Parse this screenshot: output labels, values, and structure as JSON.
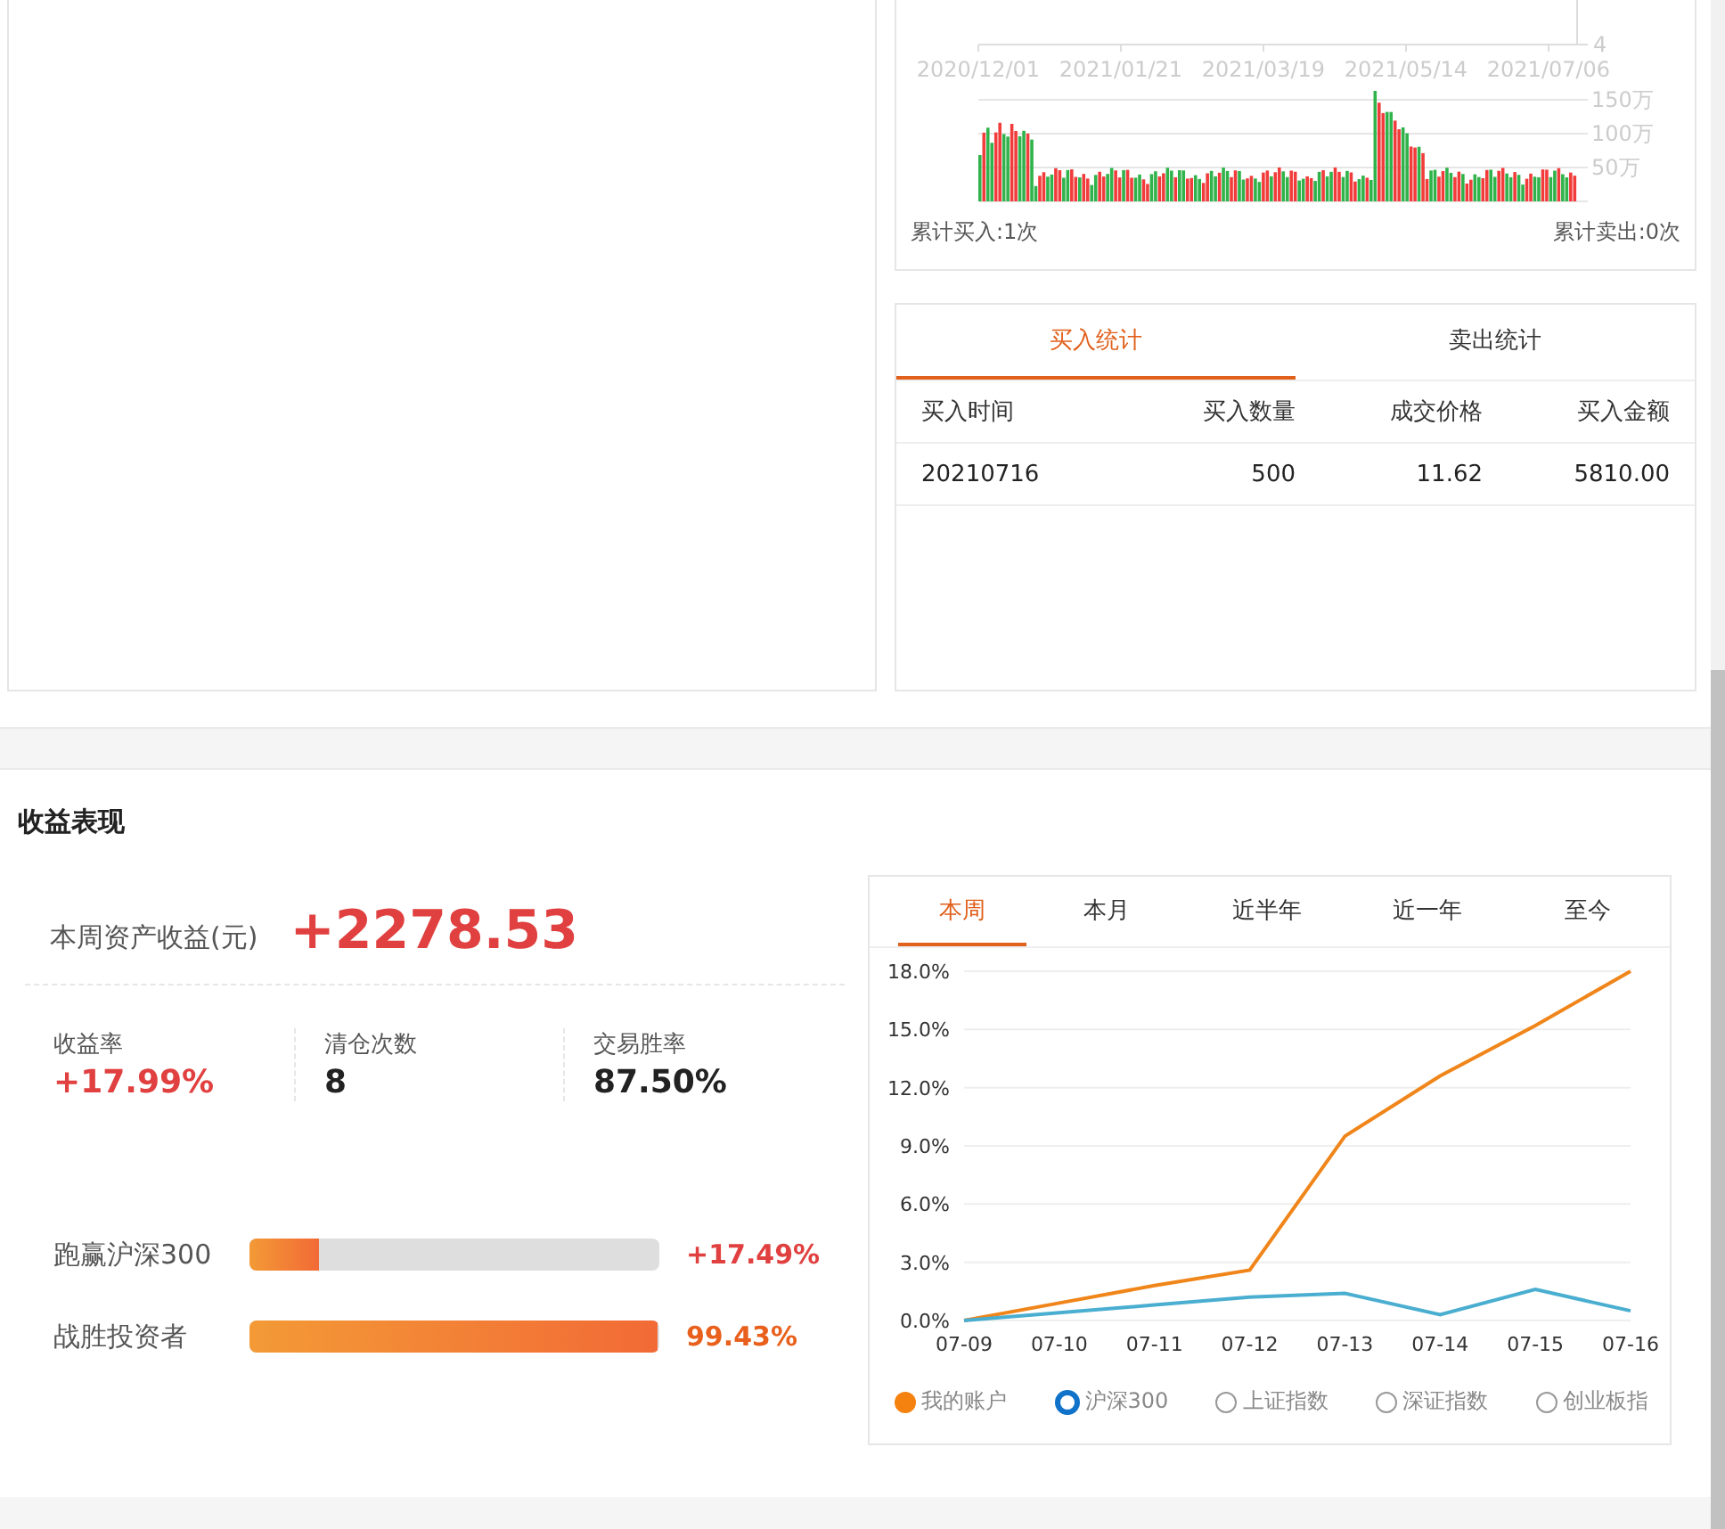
{
  "trade_chart": {
    "date_labels": [
      "2020/12/01",
      "2021/01/21",
      "2021/03/19",
      "2021/05/14",
      "2021/07/06"
    ],
    "price_label": "4",
    "volume_labels": [
      "150万",
      "100万",
      "50万"
    ],
    "buy_count": "累计买入:1次",
    "sell_count": "累计卖出:0次"
  },
  "trade_stats": {
    "tabs": [
      {
        "label": "买入统计",
        "selected": true
      },
      {
        "label": "卖出统计",
        "selected": false
      }
    ],
    "columns": [
      "买入时间",
      "买入数量",
      "成交价格",
      "买入金额"
    ],
    "rows": [
      [
        "20210716",
        "500",
        "11.62",
        "5810.00"
      ]
    ]
  },
  "performance": {
    "title": "收益表现",
    "weekly_profit": {
      "label": "本周资产收益(元)",
      "value": "+2278.53"
    },
    "stats": [
      {
        "label": "收益率",
        "value": "+17.99%",
        "positive": true
      },
      {
        "label": "清仓次数",
        "value": "8",
        "positive": false
      },
      {
        "label": "交易胜率",
        "value": "87.50%",
        "positive": false
      }
    ],
    "bars": [
      {
        "label": "跑赢沪深300",
        "level": 0.17,
        "reading": "+17.49%",
        "color": "#e0403f"
      },
      {
        "label": "战胜投资者",
        "level": 0.995,
        "reading": "99.43%",
        "color": "#e8601c"
      }
    ],
    "period_tabs": [
      {
        "label": "本周",
        "selected": true
      },
      {
        "label": "本月",
        "selected": false
      },
      {
        "label": "近半年",
        "selected": false
      },
      {
        "label": "近一年",
        "selected": false
      },
      {
        "label": "至今",
        "selected": false
      }
    ],
    "chart_data": {
      "type": "line",
      "categories": [
        "07-09",
        "07-10",
        "07-11",
        "07-12",
        "07-13",
        "07-14",
        "07-15",
        "07-16"
      ],
      "yticks": [
        {
          "value": 0,
          "label": "0.0%"
        },
        {
          "value": 3,
          "label": "3.0%"
        },
        {
          "value": 6,
          "label": "6.0%"
        },
        {
          "value": 9,
          "label": "9.0%"
        },
        {
          "value": 12,
          "label": "12.0%"
        },
        {
          "value": 15,
          "label": "15.0%"
        },
        {
          "value": 18,
          "label": "18.0%"
        }
      ],
      "ylim": [
        0,
        18
      ],
      "grid": true,
      "series": [
        {
          "name": "我的账户",
          "color": "#f0851a",
          "values": [
            0,
            0.9,
            1.8,
            2.6,
            9.5,
            12.6,
            15.2,
            18.0
          ]
        },
        {
          "name": "沪深300",
          "color": "#4aaed0",
          "values": [
            0,
            0.4,
            0.8,
            1.2,
            1.4,
            0.3,
            1.6,
            0.5
          ]
        }
      ]
    },
    "series_legend": [
      {
        "on": true,
        "kind": "filled",
        "color": "#f5820f"
      },
      {
        "on": true,
        "kind": "ring",
        "color": "#1072c8"
      }
    ],
    "legend": [
      {
        "label": "上证指数",
        "on": false,
        "kind": "ring",
        "color": "#999999"
      },
      {
        "label": "深证指数",
        "on": false,
        "kind": "ring",
        "color": "#999999"
      },
      {
        "label": "创业板指",
        "on": false,
        "kind": "ring",
        "color": "#999999"
      }
    ]
  }
}
